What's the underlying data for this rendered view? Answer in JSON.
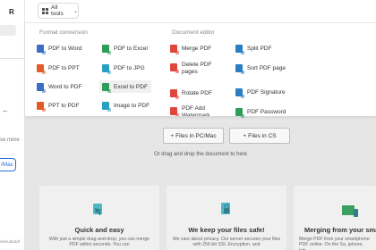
{
  "sidebar": {
    "logo": "R",
    "text_fragment": "se more",
    "button_fragment": "/Mac",
    "link_fragment": "s/ecudoadl"
  },
  "topbar": {
    "tools_label": "All tools"
  },
  "format_conversion": {
    "title": "Format conversion",
    "items": [
      {
        "label": "PDF to Word",
        "icon": "pdf-to-word-icon",
        "color": "#3a6fc4"
      },
      {
        "label": "PDF to PPT",
        "icon": "pdf-to-ppt-icon",
        "color": "#e25b2a"
      },
      {
        "label": "Word to PDF",
        "icon": "word-to-pdf-icon",
        "color": "#3a6fc4"
      },
      {
        "label": "PPT to PDF",
        "icon": "ppt-to-pdf-icon",
        "color": "#e25b2a"
      },
      {
        "label": "PDF to Excel",
        "icon": "pdf-to-excel-icon",
        "color": "#2e9d5a"
      },
      {
        "label": "PDF to JPG",
        "icon": "pdf-to-jpg-icon",
        "color": "#2a9fbf"
      },
      {
        "label": "Excel to PDF",
        "icon": "excel-to-pdf-icon",
        "color": "#2e9d5a"
      },
      {
        "label": "Image to PDF",
        "icon": "image-to-pdf-icon",
        "color": "#2a9fbf"
      }
    ]
  },
  "document_editor": {
    "title": "Document editor",
    "items": [
      {
        "label": "Merge PDF",
        "icon": "merge-pdf-icon",
        "color": "#e0463b"
      },
      {
        "label": "Delete PDF pages",
        "icon": "delete-pages-icon",
        "color": "#e0463b"
      },
      {
        "label": "Rotate PDF",
        "icon": "rotate-pdf-icon",
        "color": "#e0463b"
      },
      {
        "label": "PDF Add Watermark",
        "icon": "watermark-icon",
        "color": "#e0463b"
      },
      {
        "label": "Split PDF",
        "icon": "split-pdf-icon",
        "color": "#2a7fc4"
      },
      {
        "label": "Sort PDF page",
        "icon": "sort-pages-icon",
        "color": "#2a7fc4"
      },
      {
        "label": "PDF Signature",
        "icon": "signature-icon",
        "color": "#2a7fc4"
      },
      {
        "label": "PDF Password",
        "icon": "password-icon",
        "color": "#2e9d5a"
      }
    ]
  },
  "upload": {
    "btn_pc": "Files in PC/Mac",
    "btn_cs": "Files in CS",
    "hint": "Or drag and drop the document to here"
  },
  "cards": [
    {
      "title": "Quick and easy",
      "body": "With just a simple drag-and-drop, you can merge PDF within seconds. You can"
    },
    {
      "title": "We keep your files safe!",
      "body": "We care about privacy. Our server secures your files with 256-bit SSL Encryption, and"
    },
    {
      "title": "Merging from your sma",
      "body": "Merge PDF from your smartphone PDF online. On the Sa, iphone, tab"
    }
  ]
}
